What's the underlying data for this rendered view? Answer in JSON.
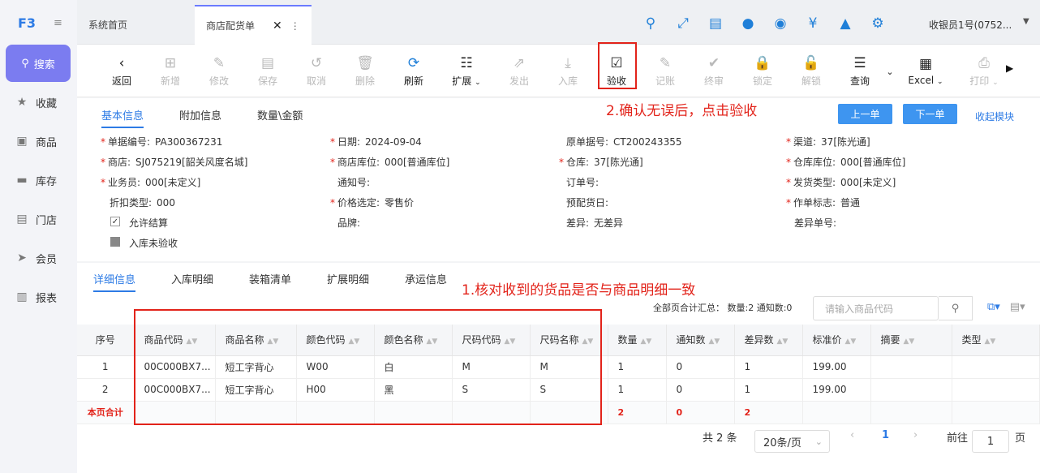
{
  "sidebar": {
    "logo": "F3",
    "collapse_icon": "≡",
    "search_label": "搜索",
    "items": [
      {
        "label": "收藏",
        "icon": "★"
      },
      {
        "label": "商品",
        "icon": "▣"
      },
      {
        "label": "库存",
        "icon": "▬"
      },
      {
        "label": "门店",
        "icon": "▤"
      },
      {
        "label": "会员",
        "icon": "➤"
      },
      {
        "label": "报表",
        "icon": "▥"
      }
    ]
  },
  "tabs": {
    "home": "系统首页",
    "active": "商店配货单",
    "close": "✕",
    "more": "⋮"
  },
  "header": {
    "user": "收银员1号(0752...",
    "caret": "▼",
    "icons": [
      "search-icon",
      "expand-icon",
      "clipboard-icon",
      "user-icon",
      "bulb-icon",
      "cash-icon",
      "shirt-icon",
      "gear-icon"
    ]
  },
  "toolbar": {
    "buttons": [
      {
        "label": "返回",
        "icon": "‹",
        "disabled": false
      },
      {
        "label": "新增",
        "icon": "⊞",
        "disabled": true
      },
      {
        "label": "修改",
        "icon": "✎",
        "disabled": true
      },
      {
        "label": "保存",
        "icon": "▤",
        "disabled": true
      },
      {
        "label": "取消",
        "icon": "↺",
        "disabled": true
      },
      {
        "label": "删除",
        "icon": "🗑",
        "disabled": true
      },
      {
        "label": "刷新",
        "icon": "⟳",
        "disabled": false
      },
      {
        "label": "扩展",
        "icon": "☷",
        "disabled": false
      },
      {
        "label": "发出",
        "icon": "⇗",
        "disabled": true
      },
      {
        "label": "入库",
        "icon": "⤓",
        "disabled": true
      },
      {
        "label": "验收",
        "icon": "☑",
        "disabled": false
      },
      {
        "label": "记账",
        "icon": "✎",
        "disabled": true
      },
      {
        "label": "终审",
        "icon": "✔",
        "disabled": true
      },
      {
        "label": "锁定",
        "icon": "🔒",
        "disabled": true
      },
      {
        "label": "解锁",
        "icon": "🔓",
        "disabled": true
      },
      {
        "label": "查询",
        "icon": "☰",
        "disabled": false
      },
      {
        "label": "Excel",
        "icon": "▦",
        "disabled": false
      },
      {
        "label": "打印",
        "icon": "⎙",
        "disabled": true
      }
    ],
    "more_arrow": "▶"
  },
  "info": {
    "tabs": [
      "基本信息",
      "附加信息",
      "数量\\金额"
    ],
    "annotation": "2.确认无误后，点击验收",
    "prev_button": "上一单",
    "next_button": "下一单",
    "collapse_link": "收起模块",
    "fields": [
      {
        "label": "单据编号:",
        "value": "PA300367231",
        "required": true
      },
      {
        "label": "日期:",
        "value": "2024-09-04",
        "required": true
      },
      {
        "label": "原单据号:",
        "value": "CT200243355",
        "required": false
      },
      {
        "label": "渠道:",
        "value": "37[陈光通]",
        "required": true
      },
      {
        "label": "商店:",
        "value": "SJ075219[韶关风度名城]",
        "required": true
      },
      {
        "label": "商店库位:",
        "value": "000[普通库位]",
        "required": true
      },
      {
        "label": "仓库:",
        "value": "37[陈光通]",
        "required": true
      },
      {
        "label": "仓库库位:",
        "value": "000[普通库位]",
        "required": true
      },
      {
        "label": "业务员:",
        "value": "000[未定义]",
        "required": true
      },
      {
        "label": "通知号:",
        "value": "",
        "required": false
      },
      {
        "label": "订单号:",
        "value": "",
        "required": false
      },
      {
        "label": "发货类型:",
        "value": "000[未定义]",
        "required": true
      },
      {
        "label": "折扣类型:",
        "value": "000",
        "required": false
      },
      {
        "label": "价格选定:",
        "value": "零售价",
        "required": true
      },
      {
        "label": "预配货日:",
        "value": "",
        "required": false
      },
      {
        "label": "作单标志:",
        "value": "普通",
        "required": true
      },
      {
        "label": "品牌:",
        "value": "",
        "required": false
      },
      {
        "label": "差异:",
        "value": "无差异",
        "required": false
      },
      {
        "label": "差异单号:",
        "value": "",
        "required": false
      }
    ],
    "checkboxes": [
      {
        "label": "允许结算",
        "checked": true
      },
      {
        "label": "入库未验收",
        "checked": false
      }
    ]
  },
  "detail": {
    "tabs": [
      "详细信息",
      "入库明细",
      "装箱清单",
      "扩展明细",
      "承运信息"
    ],
    "annotation": "1.核对收到的货品是否与商品明细一致",
    "summary": "全部页合计汇总：  数量:2  通知数:0",
    "search_placeholder": "请输入商品代码",
    "columns": [
      "序号",
      "商品代码",
      "商品名称",
      "颜色代码",
      "颜色名称",
      "尺码代码",
      "尺码名称",
      "数量",
      "通知数",
      "差异数",
      "标准价",
      "摘要",
      "类型"
    ],
    "rows": [
      [
        "1",
        "00C000BX7...",
        "短工字背心",
        "W00",
        "白",
        "M",
        "M",
        "1",
        "0",
        "1",
        "199.00",
        "",
        ""
      ],
      [
        "2",
        "00C000BX7...",
        "短工字背心",
        "H00",
        "黑",
        "S",
        "S",
        "1",
        "0",
        "1",
        "199.00",
        "",
        ""
      ]
    ],
    "total_row": [
      "本页合计",
      "",
      "",
      "",
      "",
      "",
      "",
      "2",
      "0",
      "2",
      "",
      "",
      ""
    ],
    "pager": {
      "total": "共 2 条",
      "page_size": "20条/页",
      "current": "1",
      "goto_label": "前往",
      "goto_value": "1",
      "page_suffix": "页"
    }
  }
}
